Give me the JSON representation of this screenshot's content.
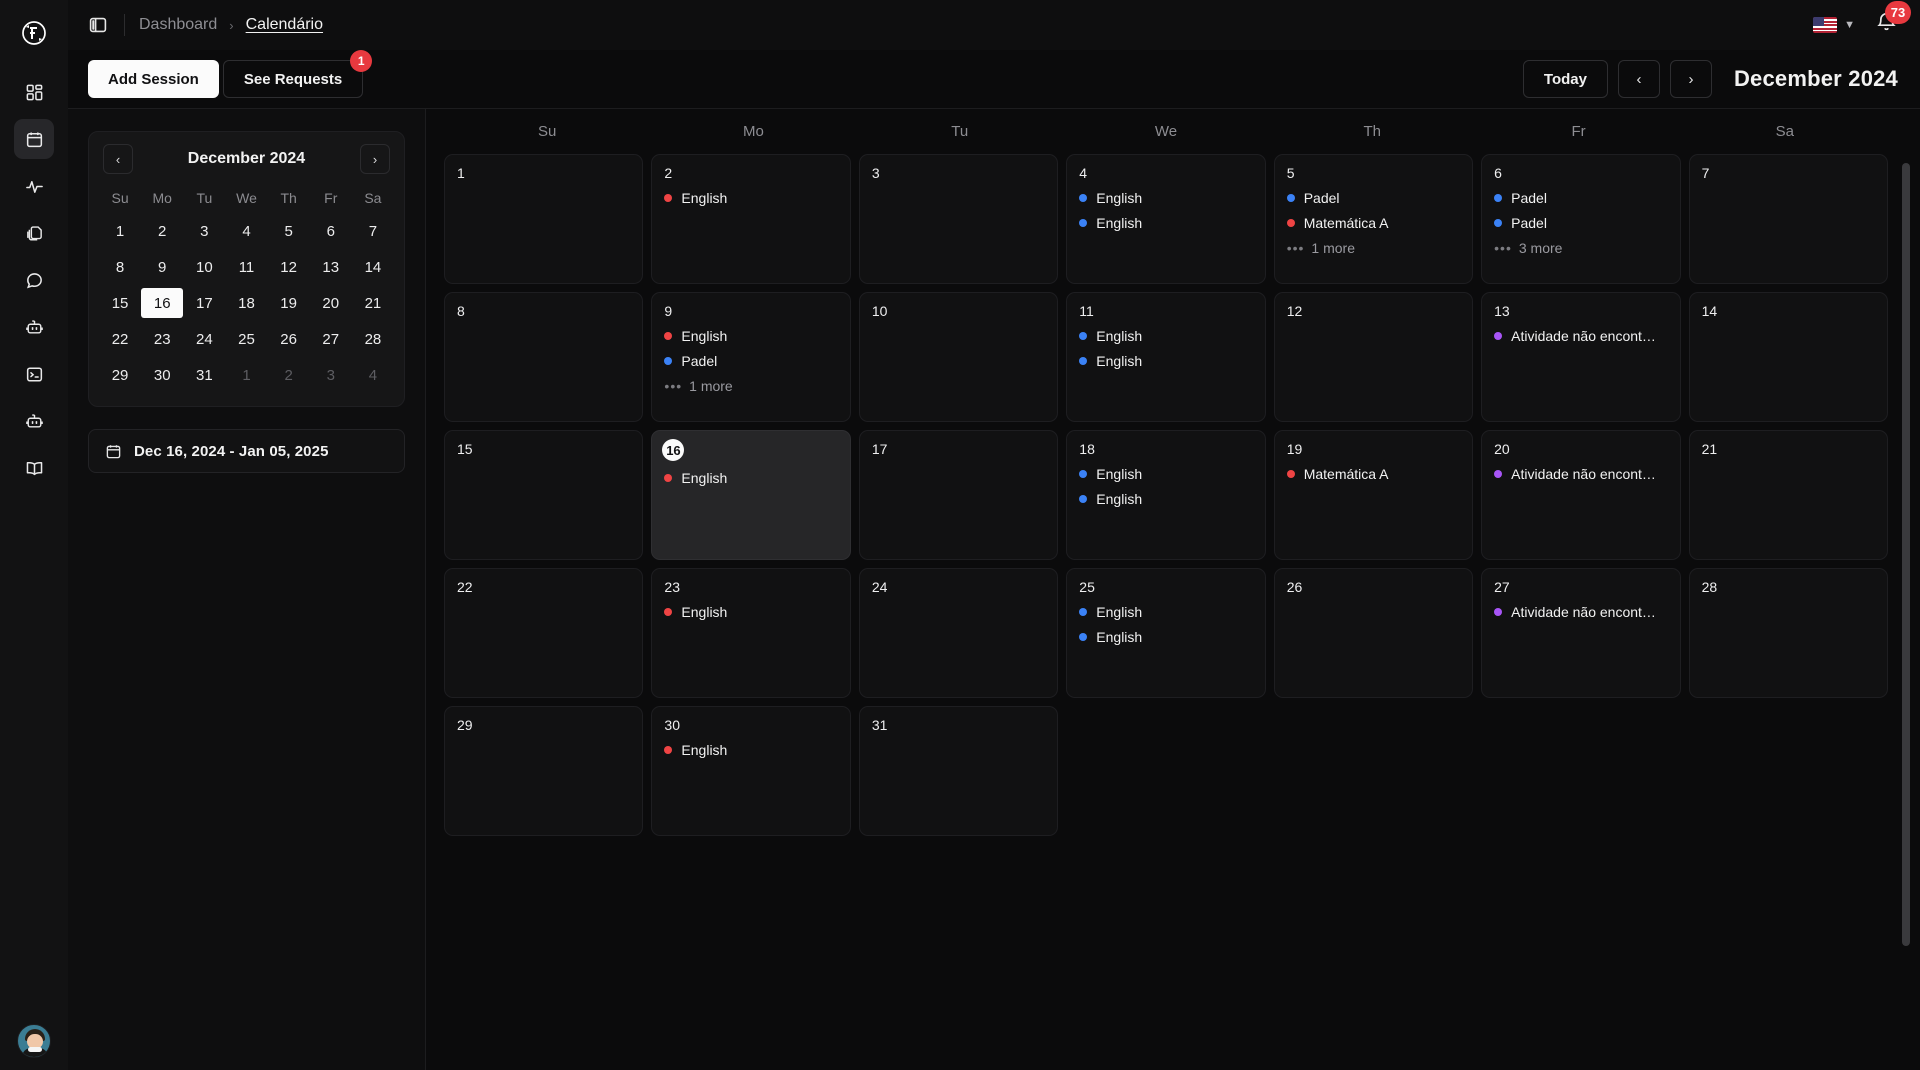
{
  "app": {
    "logo_icon": "f3-circular-logo",
    "panel_toggle_icon": "sidebar-panel-toggle-icon"
  },
  "rail": {
    "items": [
      {
        "icon": "grid-dashboard-icon",
        "name": "dashboard",
        "active": false
      },
      {
        "icon": "calendar-icon",
        "name": "calendar",
        "active": true
      },
      {
        "icon": "activity-pulse-icon",
        "name": "activity",
        "active": false
      },
      {
        "icon": "copy-files-icon",
        "name": "files",
        "active": false
      },
      {
        "icon": "chat-bubble-icon",
        "name": "messages",
        "active": false
      },
      {
        "icon": "robot-icon",
        "name": "assistant",
        "active": false
      },
      {
        "icon": "terminal-icon",
        "name": "terminal",
        "active": false
      },
      {
        "icon": "robot-icon",
        "name": "agents",
        "active": false
      },
      {
        "icon": "book-open-icon",
        "name": "library",
        "active": false
      }
    ],
    "avatar_name": "user-avatar"
  },
  "topbar": {
    "breadcrumbs": [
      {
        "label": "Dashboard",
        "current": false
      },
      {
        "label": "Calendário",
        "current": true
      }
    ],
    "separator": "›",
    "language": {
      "flag": "us-flag-icon",
      "chevron": "⌄"
    },
    "notifications": {
      "icon": "bell-icon",
      "count": "73",
      "badge_color": "#e8393f"
    }
  },
  "actionbar": {
    "add_session_label": "Add Session",
    "see_requests_label": "See Requests",
    "requests_badge": "1",
    "today_label": "Today",
    "prev_label": "‹",
    "next_label": "›",
    "month_title": "December 2024"
  },
  "minicalendar": {
    "title": "December 2024",
    "prev_label": "‹",
    "next_label": "›",
    "dow": [
      "Su",
      "Mo",
      "Tu",
      "We",
      "Th",
      "Fr",
      "Sa"
    ],
    "weeks": [
      [
        {
          "d": "1"
        },
        {
          "d": "2"
        },
        {
          "d": "3"
        },
        {
          "d": "4"
        },
        {
          "d": "5"
        },
        {
          "d": "6"
        },
        {
          "d": "7"
        }
      ],
      [
        {
          "d": "8"
        },
        {
          "d": "9"
        },
        {
          "d": "10"
        },
        {
          "d": "11"
        },
        {
          "d": "12"
        },
        {
          "d": "13"
        },
        {
          "d": "14"
        }
      ],
      [
        {
          "d": "15"
        },
        {
          "d": "16",
          "sel": true
        },
        {
          "d": "17"
        },
        {
          "d": "18"
        },
        {
          "d": "19"
        },
        {
          "d": "20"
        },
        {
          "d": "21"
        }
      ],
      [
        {
          "d": "22"
        },
        {
          "d": "23"
        },
        {
          "d": "24"
        },
        {
          "d": "25"
        },
        {
          "d": "26"
        },
        {
          "d": "27"
        },
        {
          "d": "28"
        }
      ],
      [
        {
          "d": "29"
        },
        {
          "d": "30"
        },
        {
          "d": "31"
        },
        {
          "d": "1",
          "muted": true
        },
        {
          "d": "2",
          "muted": true
        },
        {
          "d": "3",
          "muted": true
        },
        {
          "d": "4",
          "muted": true
        }
      ]
    ]
  },
  "daterange": {
    "icon": "calendar-icon",
    "value": "Dec 16, 2024 - Jan 05, 2025"
  },
  "calendar": {
    "dow": [
      "Su",
      "Mo",
      "Tu",
      "We",
      "Th",
      "Fr",
      "Sa"
    ],
    "event_colors": {
      "red": "#ef4444",
      "blue": "#3b82f6",
      "purple": "#a855f7"
    },
    "weeks": [
      [
        {
          "day": "1",
          "events": []
        },
        {
          "day": "2",
          "events": [
            {
              "label": "English",
              "color": "red"
            }
          ]
        },
        {
          "day": "3",
          "events": []
        },
        {
          "day": "4",
          "events": [
            {
              "label": "English",
              "color": "blue"
            },
            {
              "label": "English",
              "color": "blue"
            }
          ]
        },
        {
          "day": "5",
          "events": [
            {
              "label": "Padel",
              "color": "blue"
            },
            {
              "label": "Matemática A",
              "color": "red"
            }
          ],
          "more": "1 more"
        },
        {
          "day": "6",
          "events": [
            {
              "label": "Padel",
              "color": "blue"
            },
            {
              "label": "Padel",
              "color": "blue"
            }
          ],
          "more": "3 more"
        },
        {
          "day": "7",
          "events": []
        }
      ],
      [
        {
          "day": "8",
          "events": []
        },
        {
          "day": "9",
          "events": [
            {
              "label": "English",
              "color": "red"
            },
            {
              "label": "Padel",
              "color": "blue"
            }
          ],
          "more": "1 more"
        },
        {
          "day": "10",
          "events": []
        },
        {
          "day": "11",
          "events": [
            {
              "label": "English",
              "color": "blue"
            },
            {
              "label": "English",
              "color": "blue"
            }
          ]
        },
        {
          "day": "12",
          "events": []
        },
        {
          "day": "13",
          "events": [
            {
              "label": "Atividade não encont…",
              "color": "purple"
            }
          ]
        },
        {
          "day": "14",
          "events": []
        }
      ],
      [
        {
          "day": "15",
          "events": []
        },
        {
          "day": "16",
          "today": true,
          "events": [
            {
              "label": "English",
              "color": "red"
            }
          ]
        },
        {
          "day": "17",
          "events": []
        },
        {
          "day": "18",
          "events": [
            {
              "label": "English",
              "color": "blue"
            },
            {
              "label": "English",
              "color": "blue"
            }
          ]
        },
        {
          "day": "19",
          "events": [
            {
              "label": "Matemática A",
              "color": "red"
            }
          ]
        },
        {
          "day": "20",
          "events": [
            {
              "label": "Atividade não encont…",
              "color": "purple"
            }
          ]
        },
        {
          "day": "21",
          "events": []
        }
      ],
      [
        {
          "day": "22",
          "events": []
        },
        {
          "day": "23",
          "events": [
            {
              "label": "English",
              "color": "red"
            }
          ]
        },
        {
          "day": "24",
          "events": []
        },
        {
          "day": "25",
          "events": [
            {
              "label": "English",
              "color": "blue"
            },
            {
              "label": "English",
              "color": "blue"
            }
          ]
        },
        {
          "day": "26",
          "events": []
        },
        {
          "day": "27",
          "events": [
            {
              "label": "Atividade não encont…",
              "color": "purple"
            }
          ]
        },
        {
          "day": "28",
          "events": []
        }
      ],
      [
        {
          "day": "29",
          "events": []
        },
        {
          "day": "30",
          "events": [
            {
              "label": "English",
              "color": "red"
            }
          ]
        },
        {
          "day": "31",
          "events": []
        },
        null,
        null,
        null,
        null
      ]
    ]
  }
}
